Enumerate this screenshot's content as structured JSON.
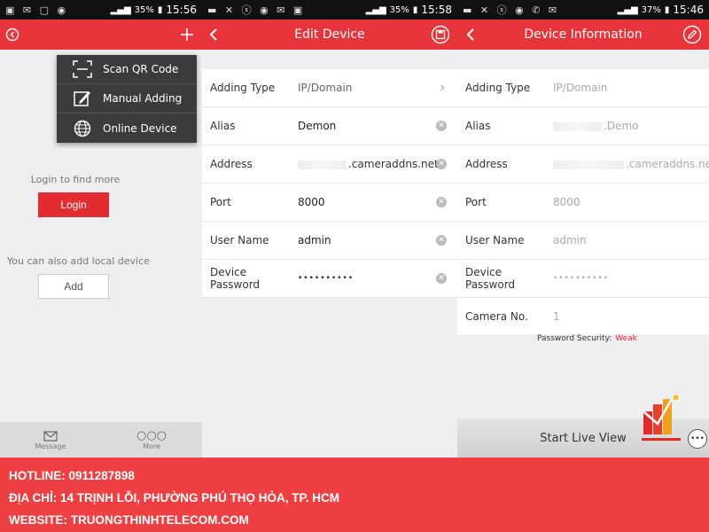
{
  "status_bars": [
    {
      "battery": "35%",
      "time": "15:56"
    },
    {
      "battery": "35%",
      "time": "15:58"
    },
    {
      "battery": "37%",
      "time": "15:46"
    }
  ],
  "home": {
    "menu": [
      {
        "label": "Scan QR Code",
        "icon": "qr-scan-icon"
      },
      {
        "label": "Manual Adding",
        "icon": "edit-icon"
      },
      {
        "label": "Online Device",
        "icon": "globe-icon"
      }
    ],
    "login_hint": "Login to find more",
    "login_button": "Login",
    "local_hint": "You can also add local device",
    "add_button": "Add",
    "nav": [
      {
        "label": "Message",
        "icon": "envelope-icon"
      },
      {
        "label": "More",
        "icon": "more-dots-icon"
      }
    ]
  },
  "edit_device": {
    "title": "Edit Device",
    "rows": [
      {
        "label": "Adding Type",
        "value": "IP/Domain",
        "type": "select"
      },
      {
        "label": "Alias",
        "value": "Demon",
        "type": "input"
      },
      {
        "label": "Address",
        "value": ".cameraddns.net",
        "type": "input"
      },
      {
        "label": "Port",
        "value": "8000",
        "type": "input"
      },
      {
        "label": "User Name",
        "value": "admin",
        "type": "input"
      },
      {
        "label": "Device Password",
        "value": "••••••••••",
        "type": "input"
      }
    ]
  },
  "device_info": {
    "title": "Device Information",
    "rows": [
      {
        "label": "Adding Type",
        "value": "IP/Domain"
      },
      {
        "label": "Alias",
        "value": ".Demo"
      },
      {
        "label": "Address",
        "value": ".cameraddns.ne"
      },
      {
        "label": "Port",
        "value": "8000"
      },
      {
        "label": "User Name",
        "value": "admin"
      },
      {
        "label": "Device Password",
        "value": "••••••••••"
      },
      {
        "label": "Camera No.",
        "value": "1"
      }
    ],
    "password_security_label": "Password Security:",
    "password_security_value": "Weak",
    "live_view_button": "Start Live View"
  },
  "banner": {
    "hotline": "HOTLINE: 0911287898",
    "address": "ĐỊA CHỈ: 14 TRỊNH LỖI, PHƯỜNG PHÚ THỌ HÒA, TP. HCM",
    "website": "WEBSITE: TRUONGTHINHTELECOM.COM"
  },
  "colors": {
    "accent": "#e8353b",
    "banner": "#ee4043",
    "menu": "#3b3b3d"
  }
}
